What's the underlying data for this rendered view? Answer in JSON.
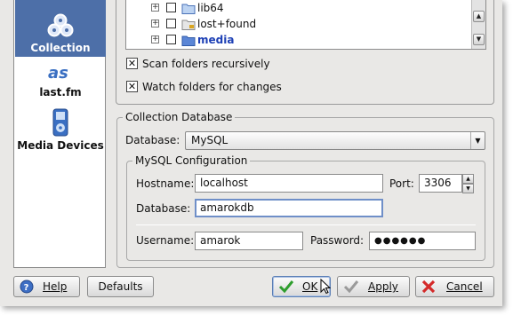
{
  "sidebar": {
    "items": [
      {
        "label": "Collection",
        "icon": "collection-icon",
        "selected": true
      },
      {
        "label": "last.fm",
        "icon": "lastfm-icon",
        "selected": false
      },
      {
        "label": "Media Devices",
        "icon": "media-device-icon",
        "selected": false
      }
    ]
  },
  "folders": {
    "tree": [
      {
        "label": "lib64",
        "expander": "+",
        "checked": false
      },
      {
        "label": "lost+found",
        "expander": "+",
        "checked": false
      },
      {
        "label": "media",
        "expander": "+",
        "checked": false
      }
    ],
    "scan_recursively": {
      "label": "Scan folders recursively",
      "checked": true
    },
    "watch_folders": {
      "label": "Watch folders for changes",
      "checked": true
    }
  },
  "collection_db": {
    "title": "Collection Database",
    "database_label": "Database:",
    "database_value": "MySQL",
    "mysql": {
      "title": "MySQL Configuration",
      "hostname_label": "Hostname:",
      "hostname_value": "localhost",
      "port_label": "Port:",
      "port_value": "3306",
      "database_label": "Database:",
      "database_value": "amarokdb",
      "username_label": "Username:",
      "username_value": "amarok",
      "password_label": "Password:",
      "password_value": "●●●●●●"
    }
  },
  "buttons": {
    "help": "Help",
    "defaults": "Defaults",
    "ok": "OK",
    "apply": "Apply",
    "cancel": "Cancel"
  },
  "colors": {
    "selection": "#4d6fa8",
    "link": "#1c3fb5",
    "ok_check": "#2e9e2e",
    "cancel_x": "#d42a2a",
    "help_icon": "#3d6ec4"
  }
}
